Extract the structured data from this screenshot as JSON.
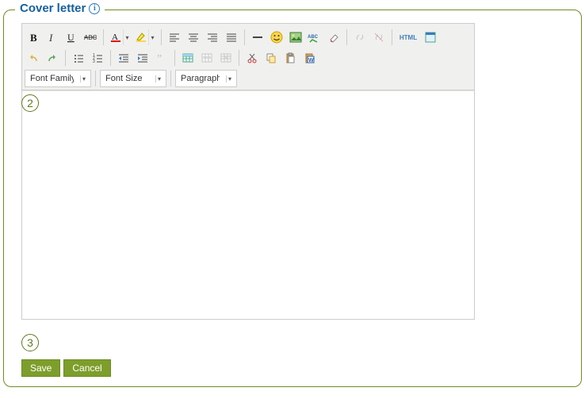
{
  "panel": {
    "title": "Cover letter",
    "info_tooltip": "i"
  },
  "steps": {
    "two": "2",
    "three": "3"
  },
  "editor": {
    "dropdowns": {
      "font_family": "Font Family",
      "font_size": "Font Size",
      "paragraph": "Paragraph"
    },
    "tools": {
      "bold": "Bold",
      "italic": "Italic",
      "underline": "Underline",
      "strike": "Strikethrough",
      "forecolor": "Text Color",
      "hilite": "Highlight",
      "align_left": "Align Left",
      "align_center": "Align Center",
      "align_right": "Align Right",
      "align_full": "Justify",
      "hr": "Horizontal Rule",
      "emoticon": "Insert Emoticon",
      "image": "Insert Image",
      "spellcheck": "Spellcheck",
      "eraser": "Remove Formatting",
      "link": "Insert Link",
      "unlink": "Remove Link",
      "html": "Edit HTML Source",
      "fullscreen": "Fullscreen",
      "undo": "Undo",
      "redo": "Redo",
      "ul": "Bullet List",
      "ol": "Numbered List",
      "outdent": "Outdent",
      "indent": "Indent",
      "blockquote": "Blockquote",
      "table_insert": "Insert Table",
      "table_row": "Table Row Props",
      "table_cell": "Table Cell Props",
      "cut": "Cut",
      "copy": "Copy",
      "paste": "Paste",
      "paste_word": "Paste from Word"
    },
    "html_label": "HTML"
  },
  "buttons": {
    "save": "Save",
    "cancel": "Cancel"
  }
}
